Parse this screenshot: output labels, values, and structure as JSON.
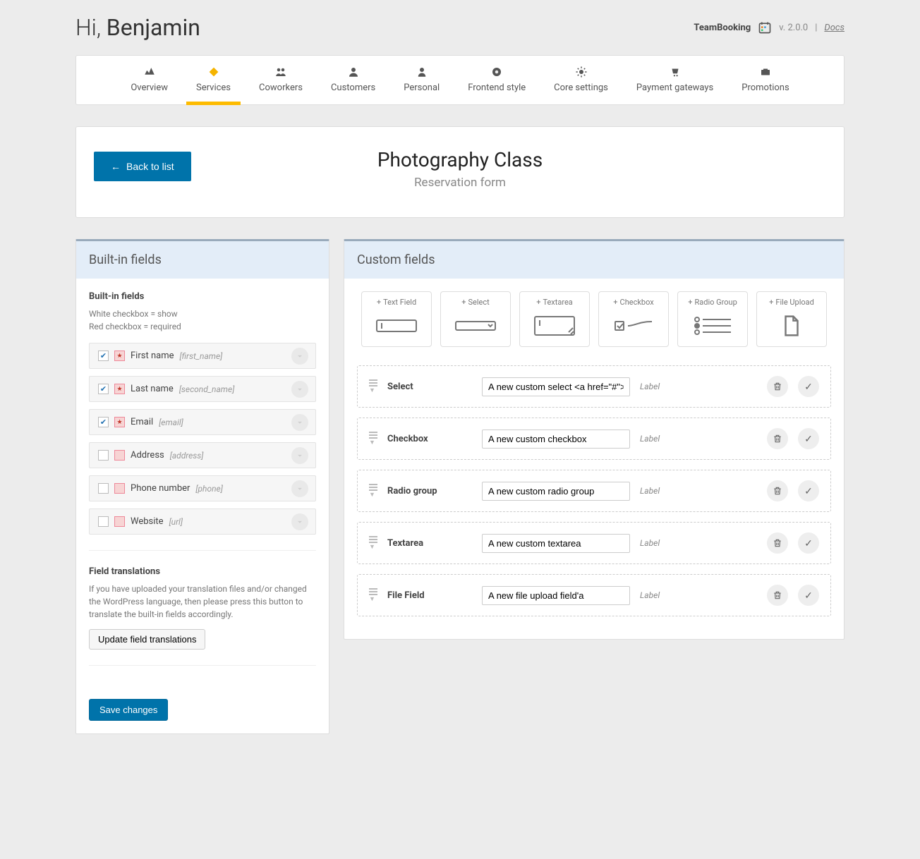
{
  "greeting_prefix": "Hi, ",
  "greeting_name": "Benjamin",
  "brand": "TeamBooking",
  "version": "v. 2.0.0",
  "docs_label": "Docs",
  "tabs": [
    "Overview",
    "Services",
    "Coworkers",
    "Customers",
    "Personal",
    "Frontend style",
    "Core settings",
    "Payment gateways",
    "Promotions"
  ],
  "active_tab": 1,
  "back_label": "Back to list",
  "page_title": "Photography Class",
  "page_subtitle": "Reservation form",
  "left": {
    "panel_title": "Built-in fields",
    "section_title": "Built-in fields",
    "legend1": "White checkbox = show",
    "legend2": "Red checkbox = required",
    "fields": [
      {
        "show": true,
        "req": true,
        "label": "First name",
        "slug": "[first_name]"
      },
      {
        "show": true,
        "req": true,
        "label": "Last name",
        "slug": "[second_name]"
      },
      {
        "show": true,
        "req": true,
        "label": "Email",
        "slug": "[email]"
      },
      {
        "show": false,
        "req": false,
        "label": "Address",
        "slug": "[address]"
      },
      {
        "show": false,
        "req": false,
        "label": "Phone number",
        "slug": "[phone]"
      },
      {
        "show": false,
        "req": false,
        "label": "Website",
        "slug": "[url]"
      }
    ],
    "trans_title": "Field translations",
    "trans_text": "If you have uploaded your translation files and/or changed the WordPress language, then please press this button to translate the built-in fields accordingly.",
    "trans_btn": "Update field translations",
    "save_btn": "Save changes"
  },
  "right": {
    "panel_title": "Custom fields",
    "add_buttons": [
      "Text Field",
      "Select",
      "Textarea",
      "Checkbox",
      "Radio Group",
      "File Upload"
    ],
    "label_tag": "Label",
    "rows": [
      {
        "type": "Select",
        "value": "A new custom select <a href=\"#\">cia"
      },
      {
        "type": "Checkbox",
        "value": "A new custom checkbox"
      },
      {
        "type": "Radio group",
        "value": "A new custom radio group"
      },
      {
        "type": "Textarea",
        "value": "A new custom textarea"
      },
      {
        "type": "File Field",
        "value": "A new file upload field'a"
      }
    ]
  },
  "chart_data": null
}
